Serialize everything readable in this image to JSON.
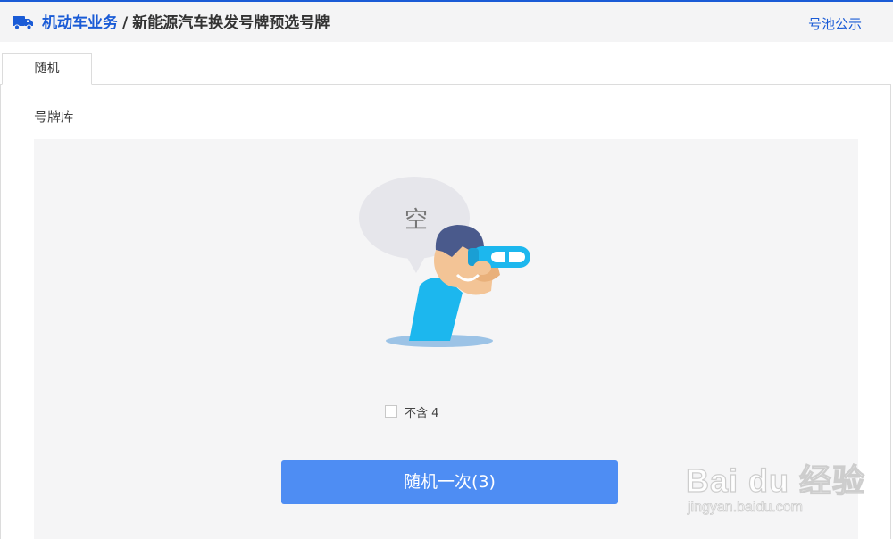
{
  "header": {
    "breadcrumb_root": "机动车业务",
    "breadcrumb_separator": "/",
    "breadcrumb_current": "新能源汽车换发号牌预选号牌",
    "pool_link": "号池公示",
    "truck_icon": "truck-icon",
    "accent_color": "#1a5bd6"
  },
  "tabs": [
    {
      "label": "随机",
      "active": true
    }
  ],
  "main": {
    "section_title": "号牌库",
    "empty_illustration_text": "空",
    "option_label": "不含 4",
    "option_checked": false,
    "random_button_label": "随机一次(3)",
    "button_color": "#4e8df3"
  },
  "watermark": {
    "logo_text": "Bai du 经验",
    "url": "jingyan.baidu.com"
  }
}
